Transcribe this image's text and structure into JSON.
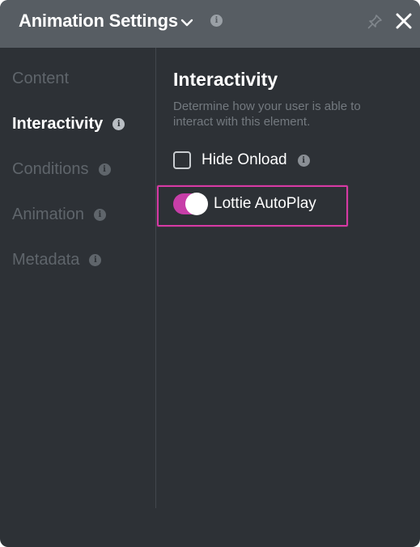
{
  "header": {
    "title": "Animation Settings",
    "chevron_icon": "chevron-down-icon",
    "info_icon": "info-icon",
    "pin_icon": "pin-icon",
    "close_icon": "close-icon"
  },
  "sidebar": {
    "items": [
      {
        "label": "Content",
        "active": false,
        "has_info": false
      },
      {
        "label": "Interactivity",
        "active": true,
        "has_info": true
      },
      {
        "label": "Conditions",
        "active": false,
        "has_info": true
      },
      {
        "label": "Animation",
        "active": false,
        "has_info": true
      },
      {
        "label": "Metadata",
        "active": false,
        "has_info": true
      }
    ]
  },
  "content": {
    "title": "Interactivity",
    "description": "Determine how your user is able to interact with this element.",
    "hide_onload": {
      "label": "Hide Onload",
      "checked": false
    },
    "lottie_autoplay": {
      "label": "Lottie AutoPlay",
      "enabled": true
    }
  },
  "colors": {
    "panel_bg": "#2d3136",
    "header_bg": "#575d63",
    "accent": "#c73ea8",
    "highlight_border": "#d63aa4"
  },
  "info_glyph": "i"
}
